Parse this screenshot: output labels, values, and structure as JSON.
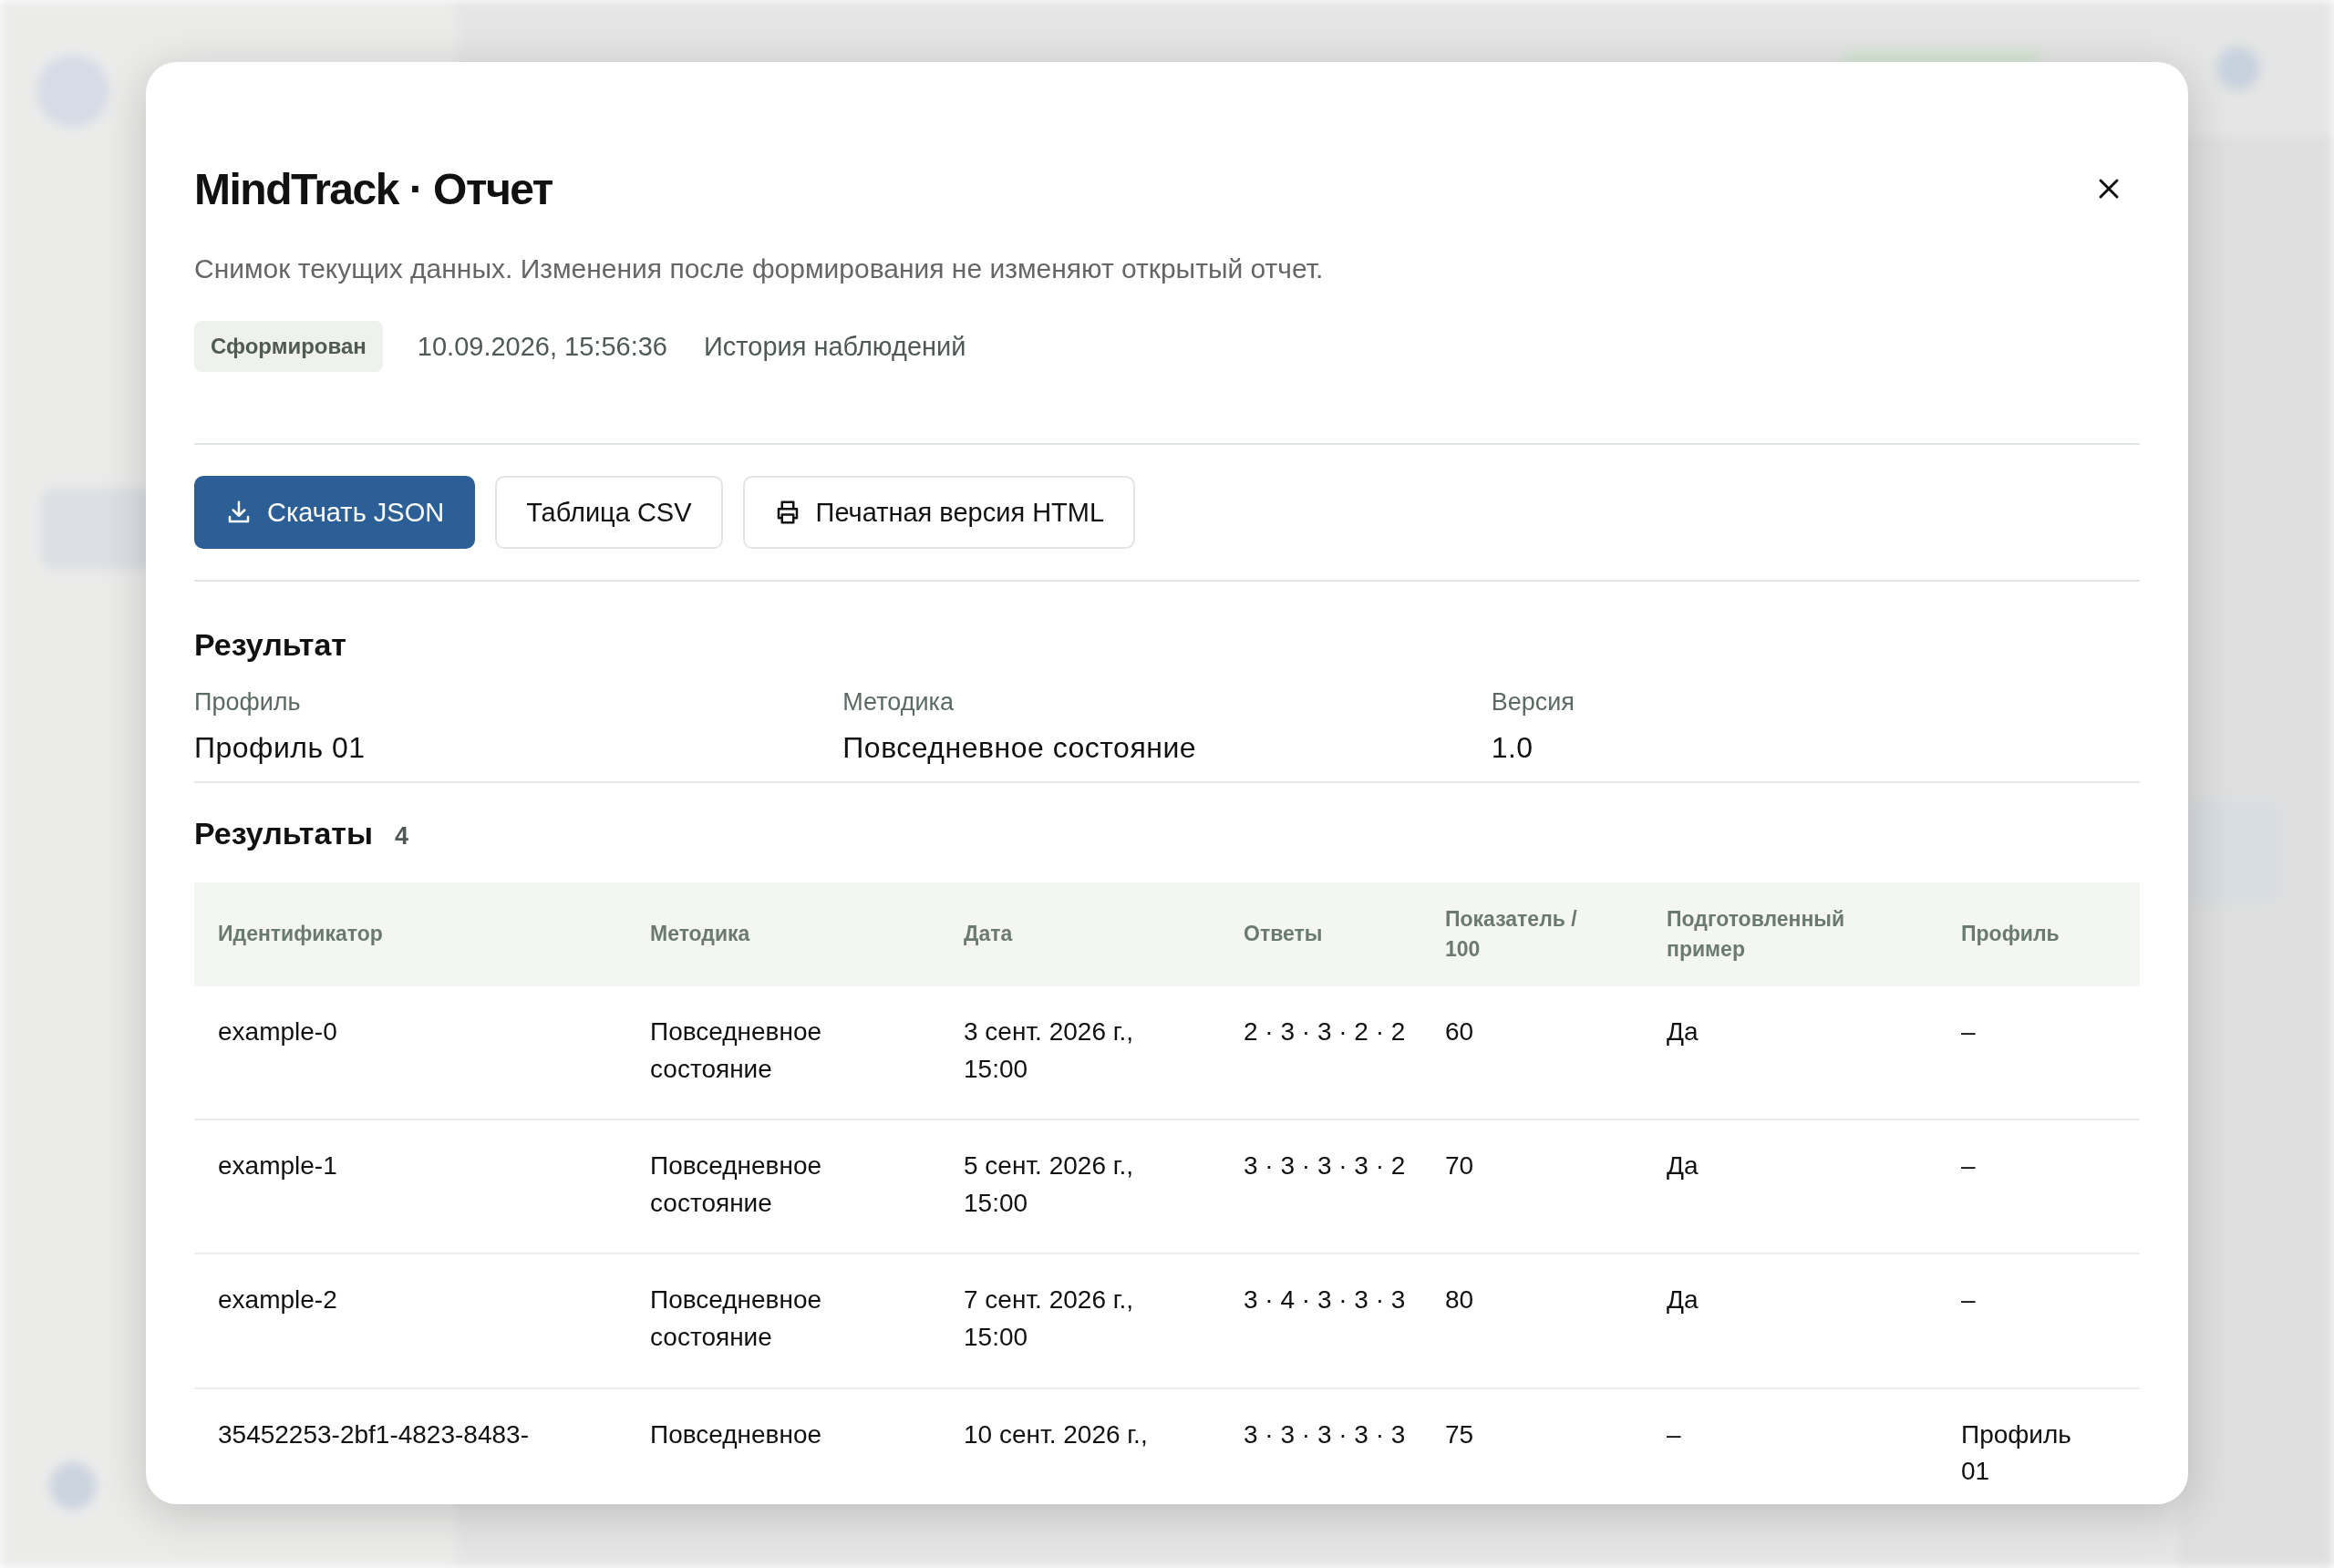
{
  "report": {
    "title": "MindTrack · Отчет",
    "description": "Снимок текущих данных. Изменения после формирования не изменяют открытый отчет.",
    "status": "Сформирован",
    "timestamp": "10.09.2026, 15:56:36",
    "source": "История наблюдений"
  },
  "actions": [
    {
      "label": "Скачать JSON",
      "kind": "download"
    },
    {
      "label": "Таблица CSV",
      "kind": "plain"
    },
    {
      "label": "Печатная версия HTML",
      "kind": "print"
    }
  ],
  "summary": {
    "title": "Результат",
    "fields": [
      {
        "label": "Профиль",
        "value": "Профиль 01"
      },
      {
        "label": "Методика",
        "value": "Повседневное состояние"
      },
      {
        "label": "Версия",
        "value": "1.0"
      }
    ]
  },
  "results": {
    "title": "Результаты",
    "count": "4",
    "columns": [
      "Идентификатор",
      "Методика",
      "Дата",
      "Ответы",
      "Показатель / 100",
      "Подготовленный пример",
      "Профиль"
    ],
    "rows": [
      [
        "example-0",
        "Повседневное состояние",
        "3 сент. 2026 г., 15:00",
        "2 · 3 · 3 · 2 · 2",
        "60",
        "Да",
        "–"
      ],
      [
        "example-1",
        "Повседневное состояние",
        "5 сент. 2026 г., 15:00",
        "3 · 3 · 3 · 3 · 2",
        "70",
        "Да",
        "–"
      ],
      [
        "example-2",
        "Повседневное состояние",
        "7 сент. 2026 г., 15:00",
        "3 · 4 · 3 · 3 · 3",
        "80",
        "Да",
        "–"
      ],
      [
        "35452253-2bf1-4823-8483-",
        "Повседневное",
        "10 сент. 2026 г.,",
        "3 · 3 · 3 · 3 · 3",
        "75",
        "–",
        "Профиль 01"
      ]
    ]
  }
}
